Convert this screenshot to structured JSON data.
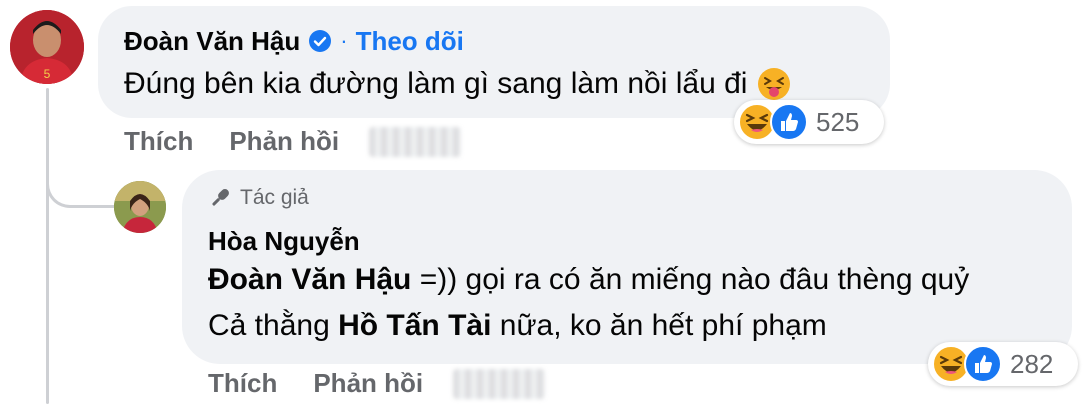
{
  "comment": {
    "author": "Đoàn Văn Hậu",
    "verified": true,
    "separator": "·",
    "follow_label": "Theo dõi",
    "text": "Đúng bên kia đường làm gì sang làm nồi lẩu đi",
    "emoji": "squinting-tongue-emoji",
    "reactions": {
      "types": [
        "haha",
        "like"
      ],
      "count": "525"
    },
    "actions": {
      "like": "Thích",
      "reply": "Phản hồi"
    }
  },
  "reply": {
    "badge_label": "Tác giả",
    "author": "Hòa Nguyễn",
    "line1": {
      "mention": "Đoàn Văn Hậu",
      "text": " =)) gọi ra có ăn miếng nào đâu thèng quỷ"
    },
    "line2": {
      "prefix": "Cả thằng ",
      "mention": "Hồ Tấn Tài",
      "suffix": " nữa, ko ăn hết phí phạm"
    },
    "reactions": {
      "types": [
        "haha",
        "like"
      ],
      "count": "282"
    },
    "actions": {
      "like": "Thích",
      "reply": "Phản hồi"
    }
  },
  "colors": {
    "bubble": "#f0f2f5",
    "link_blue": "#1877f2",
    "muted_text": "#65676b",
    "haha_yellow": "#f7b125",
    "like_blue": "#1877f2"
  }
}
